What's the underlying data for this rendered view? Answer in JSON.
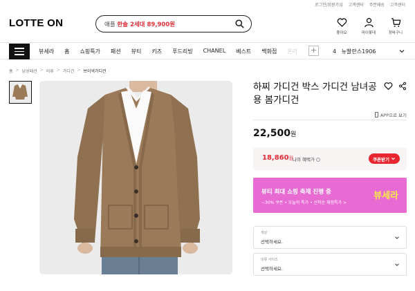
{
  "util_links": [
    "로그인/회원가입",
    "고객센터",
    "주문배송",
    "고객센터"
  ],
  "header": {
    "logo": "LOTTE ON",
    "search_prefix": "애플",
    "search_highlight": "한솔 2세대 89,900원",
    "icons": [
      {
        "name": "heart-icon",
        "label": "좋아요"
      },
      {
        "name": "user-icon",
        "label": "마이롯데"
      },
      {
        "name": "cart-icon",
        "label": "장바구니"
      }
    ]
  },
  "nav": {
    "items": [
      "뷰세라",
      "홈",
      "쇼핑특가",
      "패션",
      "뷰티",
      "키즈",
      "푸드리빙",
      "CHANEL",
      "베스트",
      "백화점"
    ],
    "faded_item": "온라",
    "rank_number": "4",
    "rank_text": "뉴발란스1906"
  },
  "breadcrumb": [
    "홈",
    "남성패션",
    "의류",
    "가디건",
    "브이넥가디건"
  ],
  "product": {
    "title": "하찌 가디건 박스 가디건 남녀공용 봄가디건",
    "app_share": "APP으로 보기",
    "price": "22,500",
    "price_unit": "원",
    "benefit_price": "18,860",
    "benefit_unit": "원",
    "benefit_label": "나의 혜택가",
    "coupon_button": "쿠폰받기"
  },
  "banner": {
    "title": "뷰티 최대 쇼핑 축제 진행 중",
    "subtitle": "~30% 쿠폰 • 오늘의 특가 • 선착순 체험특가 >",
    "logo": "뷰세라"
  },
  "options": [
    {
      "label": "색상",
      "value": "선택하세요."
    },
    {
      "label": "의류 사이즈",
      "value": "선택하세요."
    }
  ],
  "colors": {
    "accent_red": "#e32b34",
    "banner_pink": "#e86ad3",
    "cardigan": "#9a7a58"
  }
}
